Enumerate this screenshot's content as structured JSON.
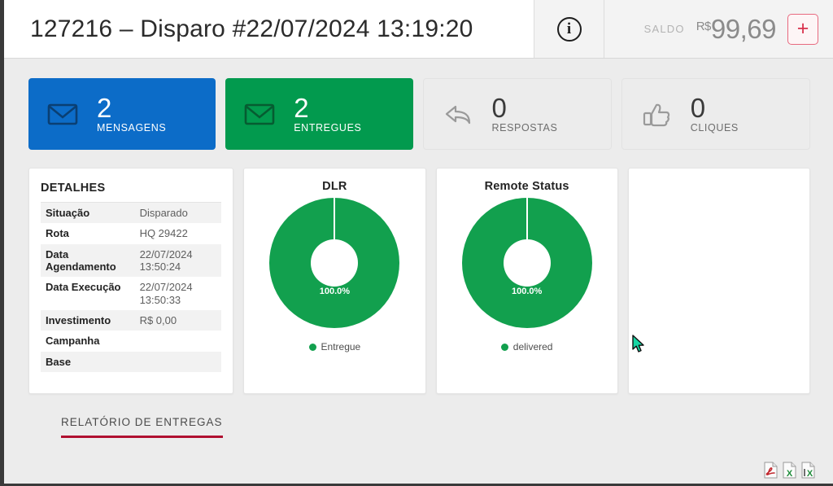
{
  "header": {
    "title": "127216 – Disparo #22/07/2024 13:19:20",
    "info_icon": "info-circle-icon",
    "saldo_label": "SALDO",
    "saldo_currency": "R$",
    "saldo_amount": "99,69",
    "add_balance_label": "+"
  },
  "stats": [
    {
      "icon": "envelope-icon",
      "value": "2",
      "label": "MENSAGENS",
      "color": "#0c6cc8",
      "style": "blue"
    },
    {
      "icon": "envelope-icon",
      "value": "2",
      "label": "ENTREGUES",
      "color": "#029a4e",
      "style": "green"
    },
    {
      "icon": "reply-arrow-icon",
      "value": "0",
      "label": "RESPOSTAS",
      "color": "#ececec",
      "style": "grey"
    },
    {
      "icon": "thumbs-up-icon",
      "value": "0",
      "label": "CLIQUES",
      "color": "#ececec",
      "style": "grey"
    }
  ],
  "details": {
    "title": "DETALHES",
    "rows": [
      {
        "key": "Situação",
        "value": "Disparado"
      },
      {
        "key": "Rota",
        "value": "HQ 29422"
      },
      {
        "key": "Data Agendamento",
        "value": "22/07/2024\n13:50:24"
      },
      {
        "key": "Data Execução",
        "value": "22/07/2024\n13:50:33"
      },
      {
        "key": "Investimento",
        "value": "R$ 0,00"
      },
      {
        "key": "Campanha",
        "value": ""
      },
      {
        "key": "Base",
        "value": ""
      }
    ]
  },
  "chart_data": [
    {
      "type": "pie",
      "title": "DLR",
      "categories": [
        "Entregue"
      ],
      "values": [
        100.0
      ],
      "data_labels": [
        "100.0%"
      ],
      "colors": [
        "#12a04e"
      ],
      "legend_position": "bottom",
      "donut": true
    },
    {
      "type": "pie",
      "title": "Remote Status",
      "categories": [
        "delivered"
      ],
      "values": [
        100.0
      ],
      "data_labels": [
        "100.0%"
      ],
      "colors": [
        "#12a04e"
      ],
      "legend_position": "bottom",
      "donut": true
    }
  ],
  "tabs": [
    {
      "label": "RELATÓRIO DE ENTREGAS",
      "active": true,
      "underline_color": "#b01030"
    }
  ],
  "export": [
    {
      "name": "export-pdf-icon",
      "format": "PDF"
    },
    {
      "name": "export-excel-icon",
      "format": "XLS"
    },
    {
      "name": "export-csv-icon",
      "format": "CSV"
    }
  ]
}
